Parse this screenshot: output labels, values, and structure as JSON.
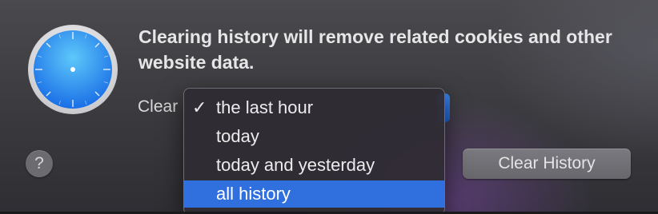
{
  "dialog": {
    "message": "Clearing history will remove related cookies and other website data.",
    "clear_label": "Clear",
    "app_icon": "safari-compass-icon",
    "help_button": "?",
    "clear_history_button": "Clear History"
  },
  "menu": {
    "checkmark": "✓",
    "items": [
      {
        "label": "the last hour",
        "selected": true,
        "highlighted": false
      },
      {
        "label": "today",
        "selected": false,
        "highlighted": false
      },
      {
        "label": "today and yesterday",
        "selected": false,
        "highlighted": false
      },
      {
        "label": "all history",
        "selected": false,
        "highlighted": true
      }
    ]
  },
  "colors": {
    "highlight": "#2f6fde",
    "button": "#6f6f74",
    "text": "#e6e6e6"
  }
}
